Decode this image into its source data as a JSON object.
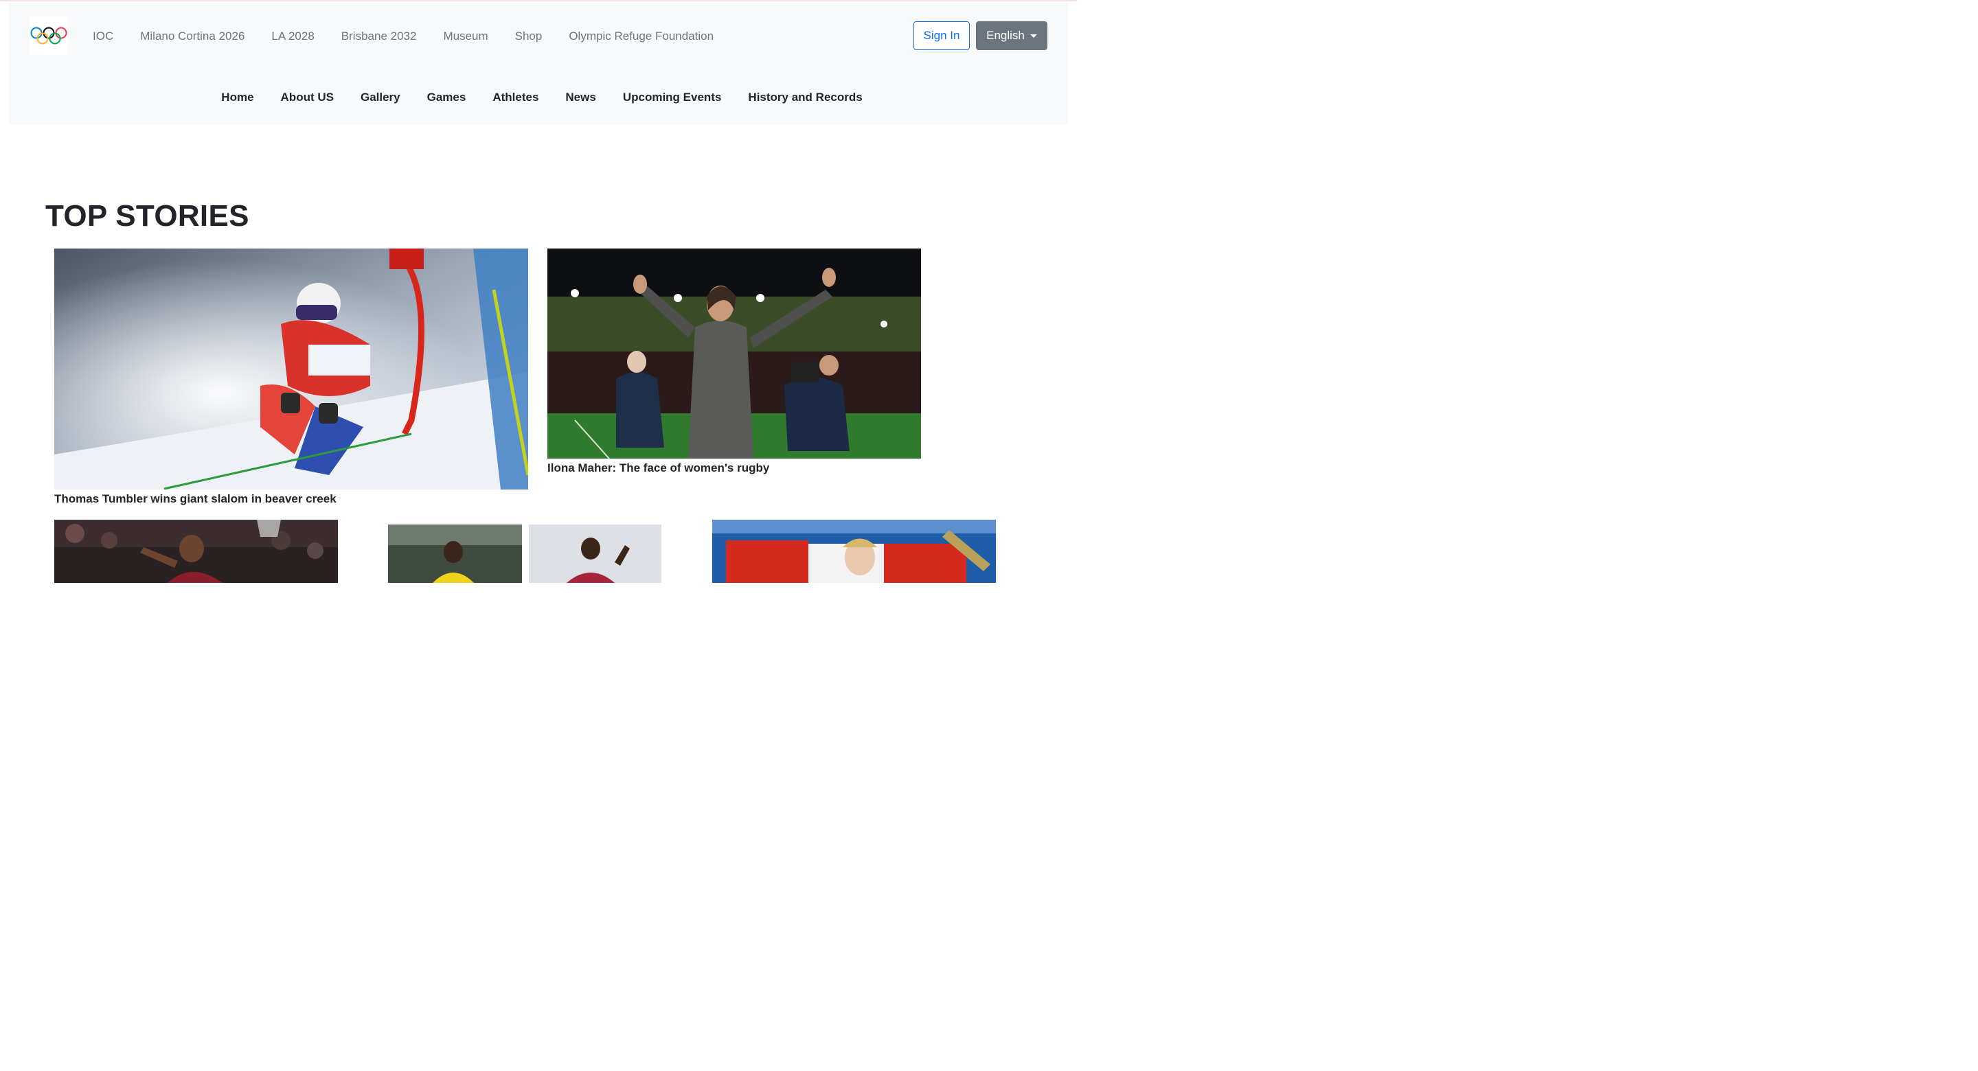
{
  "header": {
    "logo_alt": "Olympic rings",
    "util_links": [
      "IOC",
      "Milano Cortina 2026",
      "LA 2028",
      "Brisbane 2032",
      "Museum",
      "Shop",
      "Olympic Refuge Foundation"
    ],
    "signin_label": "Sign In",
    "language_label": "English",
    "main_links": [
      "Home",
      "About US",
      "Gallery",
      "Games",
      "Athletes",
      "News",
      "Upcoming Events",
      "History and Records"
    ]
  },
  "colors": {
    "accent": "#0d6efd",
    "secondary": "#6c757d",
    "header_bg": "#f8f9fa"
  },
  "top_stories": {
    "title": "TOP STORIES",
    "items": [
      {
        "caption": "Thomas Tumbler wins giant slalom in beaver creek",
        "image": "skier-photo"
      },
      {
        "caption": "Ilona Maher: The face of women's rugby",
        "image": "rugby-player-photo"
      },
      {
        "caption": "",
        "image": "basketball-player-photo"
      },
      {
        "caption": "",
        "image": "runners-photo"
      },
      {
        "caption": "",
        "image": "swimmer-with-flag-photo"
      }
    ]
  }
}
